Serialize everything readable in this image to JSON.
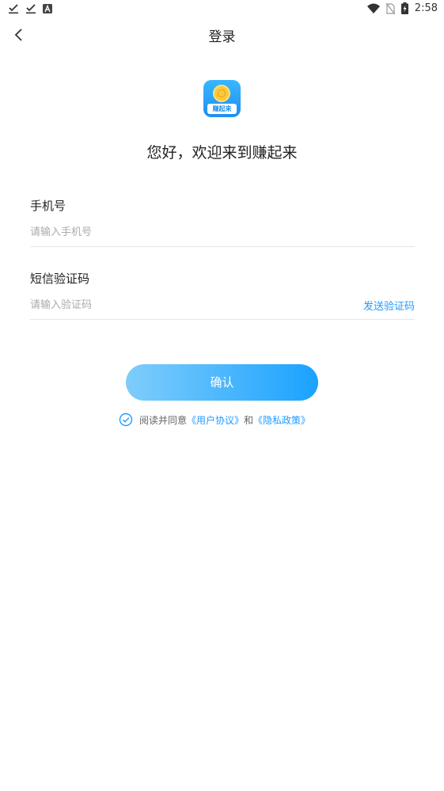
{
  "status_bar": {
    "time": "2:58",
    "left_icons": [
      "check-download-icon",
      "check-download-icon",
      "a-box-icon"
    ],
    "right_icons": [
      "wifi-icon",
      "no-sim-icon",
      "battery-charging-icon"
    ]
  },
  "header": {
    "title": "登录"
  },
  "logo": {
    "text": "赚起来"
  },
  "welcome": "您好，欢迎来到赚起来",
  "phone": {
    "label": "手机号",
    "placeholder": "请输入手机号",
    "value": ""
  },
  "sms": {
    "label": "短信验证码",
    "placeholder": "请输入验证码",
    "value": "",
    "send_label": "发送验证码"
  },
  "confirm_label": "确认",
  "agreement": {
    "prefix": "阅读并同意",
    "user_link": "《用户协议》",
    "and": "和",
    "privacy_link": "《隐私政策》",
    "checked": true
  },
  "colors": {
    "accent": "#1f9bff",
    "button_start": "#7fcdfb",
    "button_end": "#1aa2ff",
    "logo_blue": "#1f8ff0",
    "coin_yellow": "#ffc83a"
  }
}
